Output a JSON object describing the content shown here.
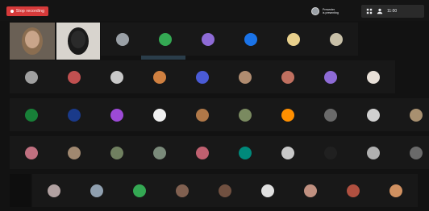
{
  "toolbar": {
    "record_label": "Stop recording",
    "presenter_name": "Presenter",
    "presenter_sub": "is presenting",
    "time": "11:00"
  },
  "colors": {
    "background": "#121212",
    "record": "#d63a3a",
    "tile": "#181818"
  },
  "grid": {
    "rows": 5,
    "cols": 10,
    "video_tiles": [
      {
        "label": "participant-video-1"
      },
      {
        "label": "participant-video-2"
      },
      {
        "label": "participant-video-3"
      }
    ],
    "avatars": [
      [
        "#9aa0a6",
        "#34a853",
        "#8e6bd6",
        "#1a73e8",
        "#e8d08c",
        "#c8c0a8"
      ],
      [
        "#a0a0a0",
        "#c05050",
        "#c8c8c8",
        "#d08040",
        "#4a5bd6",
        "#b08c70",
        "#c07060",
        "#8e6bd6",
        "#e8e0d8"
      ],
      [
        "#188038",
        "#1a3a8a",
        "#9c4ad6",
        "#f0f0f0",
        "#b07848",
        "#7a8a60",
        "#ff8f00",
        "#6a6a6a",
        "#d0d0d0",
        "#a89070"
      ],
      [
        "#c07080",
        "#a08870",
        "#708060",
        "#7a8a7a",
        "#c06070",
        "#00897b",
        "#c8c8c8",
        "#202020",
        "#b0b0b0",
        "#6a6a6a"
      ],
      [
        "#b0a0a0",
        "#90a0b0",
        "#34a853",
        "#806050",
        "#705040",
        "#e0e0e0",
        "#c09080",
        "#b05040",
        "#d09060"
      ]
    ]
  }
}
